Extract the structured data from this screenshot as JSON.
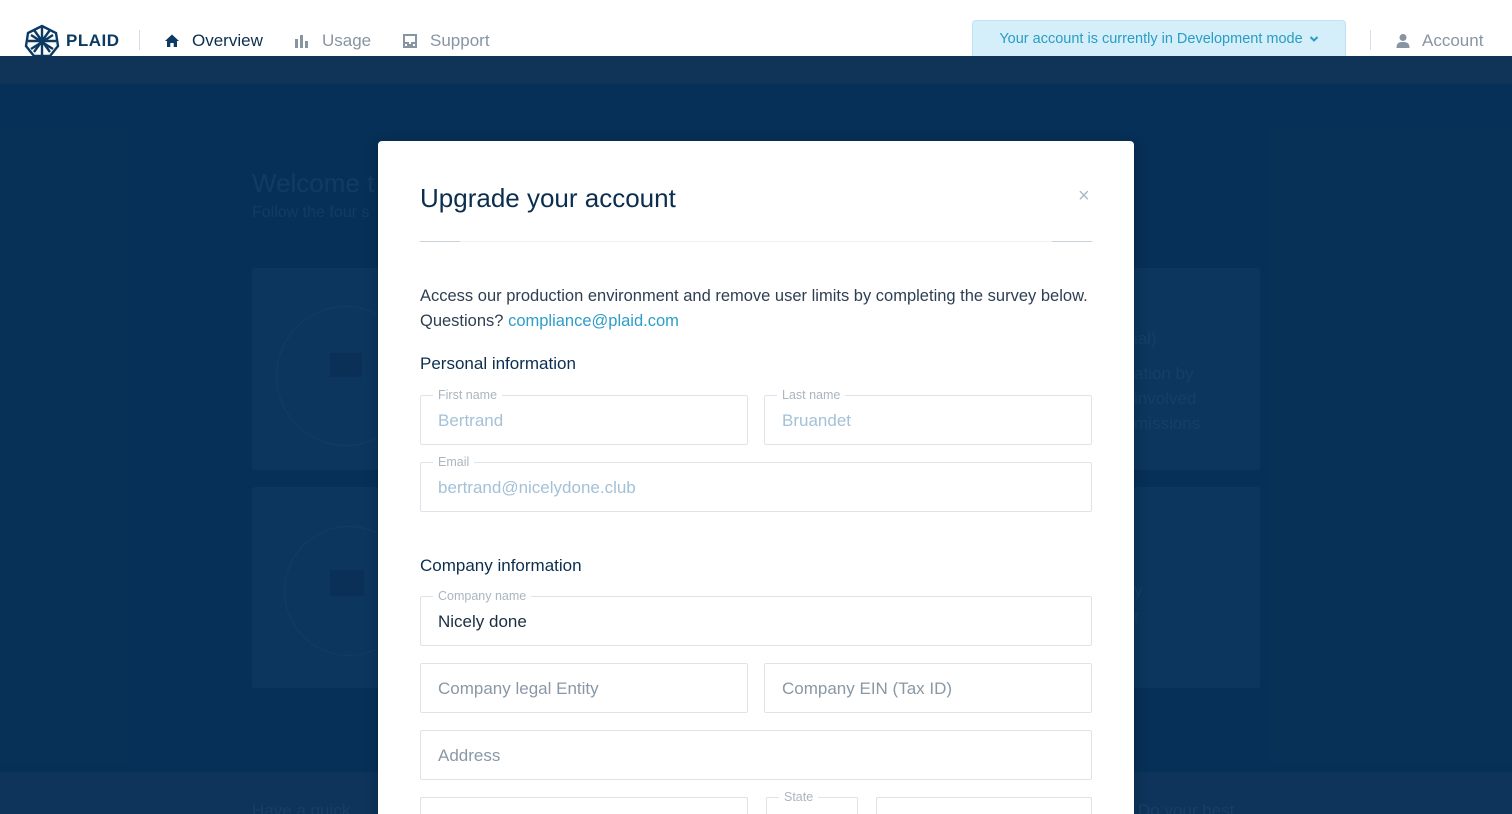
{
  "nav": {
    "brand": "PLAID",
    "items": [
      {
        "label": "Overview",
        "icon": "home-icon",
        "active": true
      },
      {
        "label": "Usage",
        "icon": "bar-chart-icon",
        "active": false
      },
      {
        "label": "Support",
        "icon": "inbox-icon",
        "active": false
      }
    ],
    "dev_mode_notice": "Your account is currently in Development mode",
    "account_label": "Account"
  },
  "background": {
    "welcome_fragment": "Welcome t",
    "subtitle_fragment": "Follow the four s",
    "card_fragments_right_top": [
      "ial)",
      "ation by",
      "involved",
      "missions"
    ],
    "card_fragments_right_bottom": [
      "y",
      "r"
    ],
    "footer_left_fragment": "Have a quick",
    "footer_right_fragment": "Do your best"
  },
  "modal": {
    "title": "Upgrade your account",
    "close_symbol": "×",
    "intro_text": "Access our production environment and remove user limits by completing the survey below. Questions? ",
    "intro_email": "compliance@plaid.com",
    "personal_section": "Personal information",
    "first_name": {
      "label": "First name",
      "value": "Bertrand"
    },
    "last_name": {
      "label": "Last name",
      "value": "Bruandet"
    },
    "email": {
      "label": "Email",
      "value": "bertrand@nicelydone.club"
    },
    "company_section": "Company information",
    "company_name": {
      "label": "Company name",
      "value": "Nicely done"
    },
    "company_legal_entity": {
      "placeholder": "Company legal Entity"
    },
    "company_ein": {
      "placeholder": "Company EIN (Tax ID)"
    },
    "address": {
      "placeholder": "Address"
    },
    "state": {
      "label": "State"
    }
  },
  "colors": {
    "brand_navy": "#0b3a63",
    "accent_blue": "#2c9ec7",
    "dev_notice_bg": "#d4effa"
  }
}
